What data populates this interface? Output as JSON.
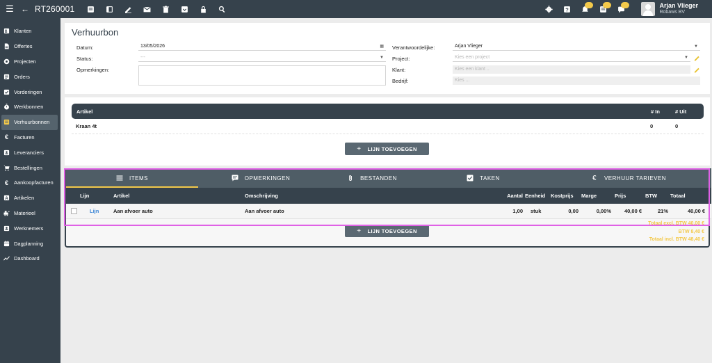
{
  "topbar": {
    "document_id": "RT260001",
    "icons": [
      "menu-icon",
      "back-icon",
      "pdf-icon",
      "layout-icon",
      "edit-icon",
      "mail-icon",
      "delete-icon",
      "archive-icon",
      "lock-icon",
      "search-icon"
    ],
    "right_icons": [
      "settings-icon",
      "help-icon",
      "notification-icon",
      "list-icon",
      "chat-icon"
    ],
    "user": {
      "name": "Arjan Vlieger",
      "company": "Robaws BV"
    }
  },
  "sidebar": {
    "items": [
      {
        "label": "Klanten",
        "icon": "contacts-icon"
      },
      {
        "label": "Offertes",
        "icon": "document-icon"
      },
      {
        "label": "Projecten",
        "icon": "project-icon"
      },
      {
        "label": "Orders",
        "icon": "order-icon"
      },
      {
        "label": "Vorderingen",
        "icon": "check-icon"
      },
      {
        "label": "Werkbonnen",
        "icon": "timer-icon"
      },
      {
        "label": "Verhuurbonnen",
        "icon": "rental-icon",
        "active": true
      },
      {
        "label": "Facturen",
        "icon": "euro-icon"
      },
      {
        "label": "Leveranciers",
        "icon": "supplier-icon"
      },
      {
        "label": "Bestellingen",
        "icon": "cart-icon"
      },
      {
        "label": "Aankoopfacturen",
        "icon": "euro-icon"
      },
      {
        "label": "Artikelen",
        "icon": "article-icon"
      },
      {
        "label": "Materieel",
        "icon": "equipment-icon"
      },
      {
        "label": "Werknemers",
        "icon": "employee-icon"
      },
      {
        "label": "Dagplanning",
        "icon": "calendar-icon"
      },
      {
        "label": "Dashboard",
        "icon": "chart-icon"
      }
    ]
  },
  "form": {
    "title": "Verhuurbon",
    "datum_label": "Datum:",
    "datum_value": "13/05/2026",
    "status_label": "Status:",
    "status_value": "---",
    "opmerkingen_label": "Opmerkingen:",
    "verantwoordelijke_label": "Verantwoordelijke:",
    "verantwoordelijke_value": "Arjan Vlieger",
    "project_label": "Project:",
    "project_placeholder": "Kies een project",
    "klant_label": "Klant:",
    "klant_placeholder": "Kies een klant ..",
    "bedrijf_label": "Bedrijf:",
    "bedrijf_placeholder": "Kies ..."
  },
  "rental_table": {
    "headers": {
      "artikel": "Artikel",
      "in": "# In",
      "uit": "# Uit"
    },
    "rows": [
      {
        "artikel": "Kraan 4t",
        "in": "0",
        "uit": "0"
      }
    ],
    "add_button": "LIJN TOEVOEGEN"
  },
  "tabs": [
    {
      "label": "ITEMS",
      "icon": "list-icon",
      "active": true
    },
    {
      "label": "OPMERKINGEN",
      "icon": "comment-icon"
    },
    {
      "label": "BESTANDEN",
      "icon": "attachment-icon"
    },
    {
      "label": "TAKEN",
      "icon": "checkbox-icon"
    },
    {
      "label": "VERHUUR TARIEVEN",
      "icon": "euro-icon"
    }
  ],
  "items_table": {
    "headers": {
      "lijn": "Lijn",
      "artikel": "Artikel",
      "omschrijving": "Omschrijving",
      "aantal": "Aantal",
      "eenheid": "Eenheid",
      "kostprijs": "Kostprijs",
      "marge": "Marge",
      "prijs": "Prijs",
      "btw": "BTW",
      "totaal": "Totaal"
    },
    "rows": [
      {
        "lijn": "Lijn",
        "artikel": "Aan afvoer auto",
        "omschrijving": "Aan afvoer auto",
        "aantal": "1,00",
        "eenheid": "stuk",
        "kostprijs": "0,00",
        "marge": "0,00%",
        "prijs": "40,00 €",
        "btw": "21%",
        "totaal": "40,00 €"
      }
    ],
    "add_button": "LIJN TOEVOEGEN",
    "totals": {
      "excl": "Totaal excl. BTW 40,00 €",
      "btw": "BTW 8,40 €",
      "incl": "Totaal incl. BTW 48,40 €"
    }
  },
  "colors": {
    "dark": "#36424c",
    "accent": "#f3c94a",
    "link": "#3a85d6",
    "selection": "#e061e6"
  }
}
